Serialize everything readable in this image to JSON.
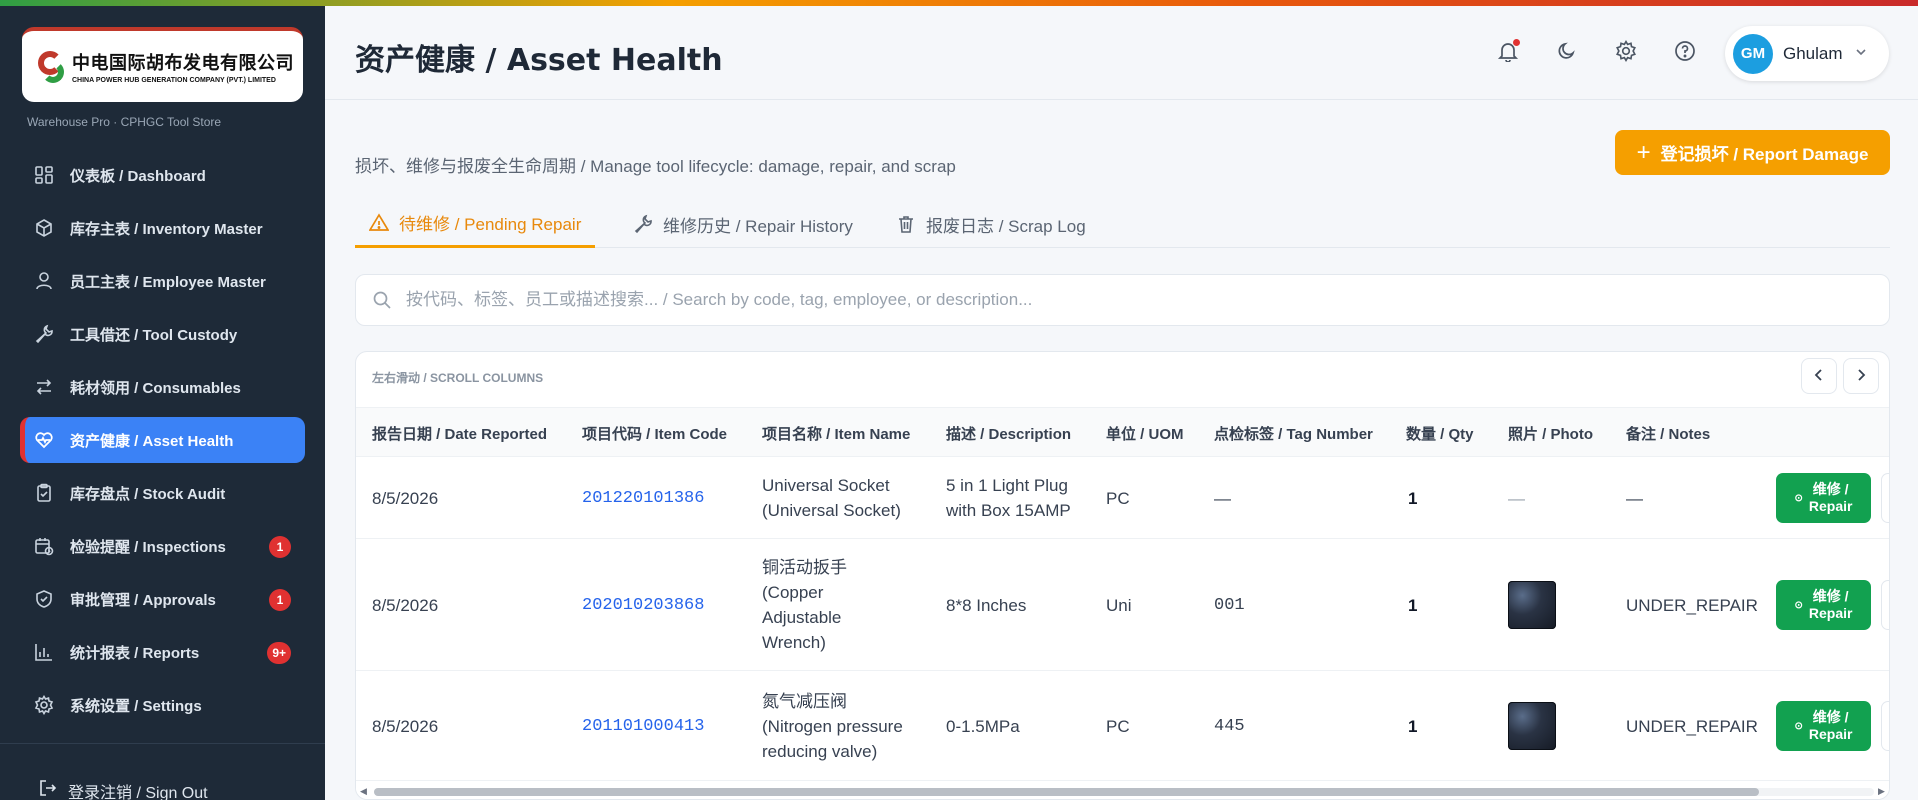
{
  "brand": {
    "name_cn": "中电国际胡布发电有限公司",
    "name_en": "CHINA POWER HUB GENERATION COMPANY (PVT.) LIMITED",
    "store_subtitle": "Warehouse Pro · CPHGC Tool Store"
  },
  "sidebar": {
    "items": [
      {
        "label": "仪表板 / Dashboard",
        "icon": "grid-icon"
      },
      {
        "label": "库存主表 / Inventory Master",
        "icon": "box-icon"
      },
      {
        "label": "员工主表 / Employee Master",
        "icon": "user-icon"
      },
      {
        "label": "工具借还 / Tool Custody",
        "icon": "wrench-icon"
      },
      {
        "label": "耗材领用 / Consumables",
        "icon": "swap-icon"
      },
      {
        "label": "资产健康 / Asset Health",
        "icon": "heart-pulse-icon",
        "active": true
      },
      {
        "label": "库存盘点 / Stock Audit",
        "icon": "clipboard-check-icon"
      },
      {
        "label": "检验提醒 / Inspections",
        "icon": "calendar-clock-icon",
        "badge": "1"
      },
      {
        "label": "审批管理 / Approvals",
        "icon": "shield-check-icon",
        "badge": "1"
      },
      {
        "label": "统计报表 / Reports",
        "icon": "bar-chart-icon",
        "badge": "9+"
      },
      {
        "label": "系统设置 / Settings",
        "icon": "gear-icon"
      }
    ],
    "signout": "登录注销 / Sign Out"
  },
  "header": {
    "title": "资产健康 / Asset Health",
    "user": {
      "initials": "GM",
      "name": "Ghulam"
    }
  },
  "main": {
    "subtitle": "损坏、维修与报废全生命周期 / Manage tool lifecycle: damage, repair, and scrap",
    "report_button": "登记损坏 / Report Damage",
    "tabs": [
      {
        "label": "待维修 / Pending Repair",
        "icon": "warning-icon",
        "active": true
      },
      {
        "label": "维修历史 / Repair History",
        "icon": "wrench-icon"
      },
      {
        "label": "报废日志 / Scrap Log",
        "icon": "trash-icon"
      }
    ],
    "search_placeholder": "按代码、标签、员工或描述搜索... / Search by code, tag, employee, or description...",
    "scroll_hint": "左右滑动 / SCROLL COLUMNS"
  },
  "table": {
    "columns": [
      "报告日期 / Date Reported",
      "项目代码 / Item Code",
      "项目名称 / Item Name",
      "描述 / Description",
      "单位 / UOM",
      "点检标签 / Tag Number",
      "数量 / Qty",
      "照片 / Photo",
      "备注 / Notes"
    ],
    "action_label_1": "维修 /",
    "action_label_2": "Repair",
    "rows": [
      {
        "date": "8/5/2026",
        "code": "201220101386",
        "name_1": "Universal Socket",
        "name_2": "(Universal Socket)",
        "name_3": "",
        "name_4": "",
        "desc_1": "5 in 1 Light Plug",
        "desc_2": "with Box 15AMP",
        "uom": "PC",
        "tag": "—",
        "qty": "1",
        "photo": "—",
        "notes": "—"
      },
      {
        "date": "8/5/2026",
        "code": "202010203868",
        "name_1": "铜活动扳手",
        "name_2": "(Copper",
        "name_3": "Adjustable",
        "name_4": "Wrench)",
        "desc_1": "8*8 Inches",
        "desc_2": "",
        "uom": "Uni",
        "tag": "001",
        "qty": "1",
        "photo": "thumbnail",
        "notes": "UNDER_REPAIR"
      },
      {
        "date": "8/5/2026",
        "code": "201101000413",
        "name_1": "氮气减压阀",
        "name_2": "(Nitrogen pressure",
        "name_3": "reducing valve)",
        "name_4": "",
        "desc_1": "0-1.5MPa",
        "desc_2": "",
        "uom": "PC",
        "tag": "445",
        "qty": "1",
        "photo": "thumbnail",
        "notes": "UNDER_REPAIR"
      }
    ]
  }
}
